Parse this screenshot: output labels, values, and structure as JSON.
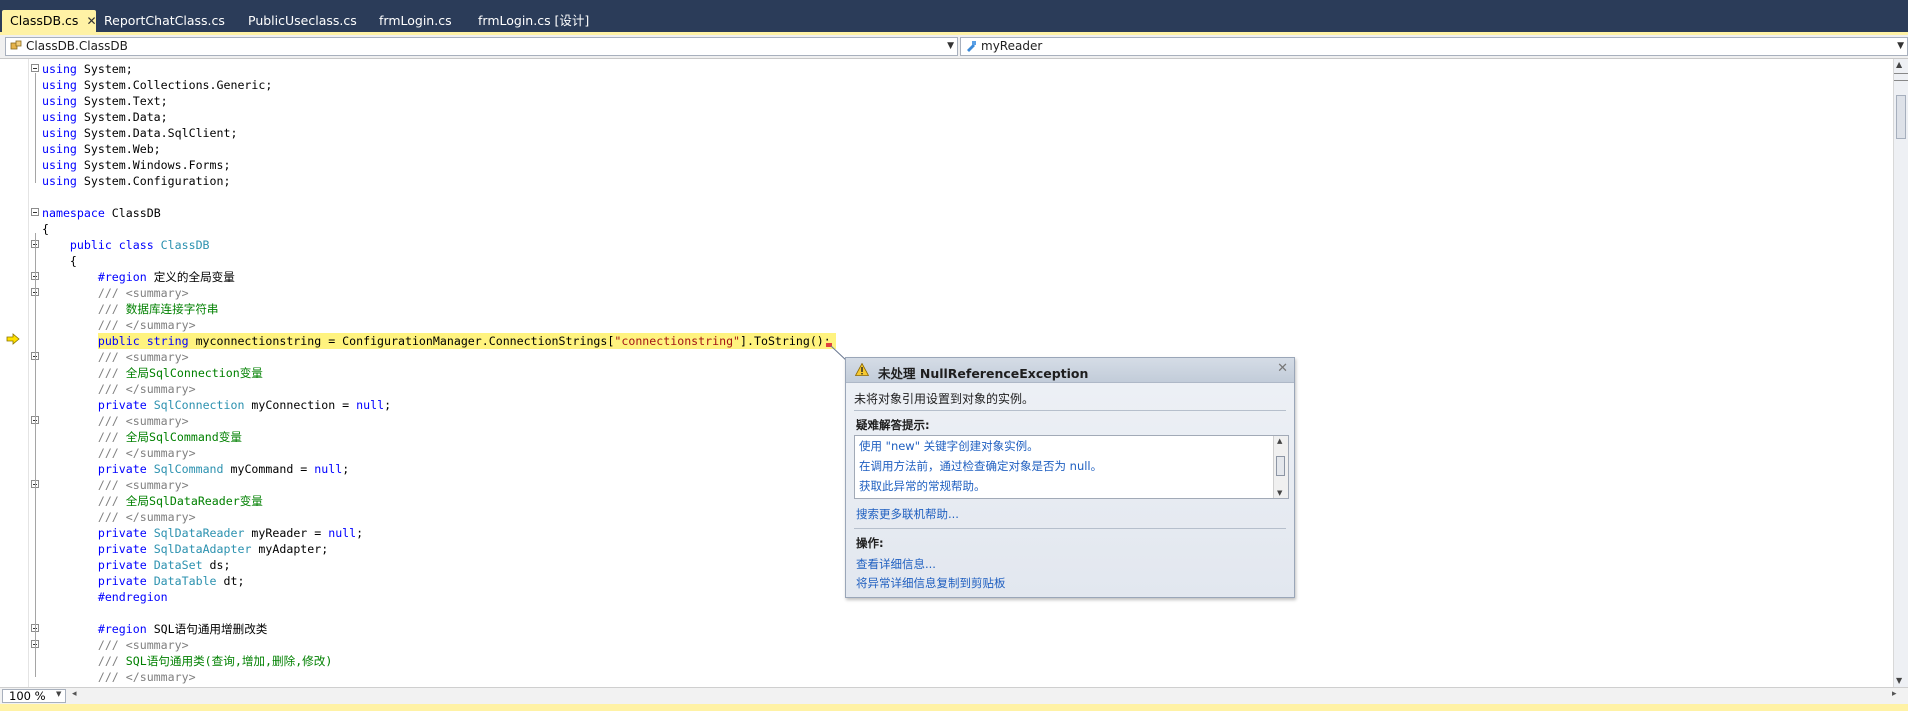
{
  "tabs": [
    {
      "label": "ClassDB.cs",
      "active": true
    },
    {
      "label": "ReportChatClass.cs",
      "active": false
    },
    {
      "label": "PublicUseclass.cs",
      "active": false
    },
    {
      "label": "frmLogin.cs",
      "active": false
    },
    {
      "label": "frmLogin.cs [设计]",
      "active": false
    }
  ],
  "nav": {
    "class_combo": "ClassDB.ClassDB",
    "member_combo": "myReader"
  },
  "code_lines": [
    [
      [
        "kw",
        "using"
      ],
      [
        "pl",
        " System;"
      ]
    ],
    [
      [
        "kw",
        "using"
      ],
      [
        "pl",
        " System.Collections.Generic;"
      ]
    ],
    [
      [
        "kw",
        "using"
      ],
      [
        "pl",
        " System.Text;"
      ]
    ],
    [
      [
        "kw",
        "using"
      ],
      [
        "pl",
        " System.Data;"
      ]
    ],
    [
      [
        "kw",
        "using"
      ],
      [
        "pl",
        " System.Data.SqlClient;"
      ]
    ],
    [
      [
        "kw",
        "using"
      ],
      [
        "pl",
        " System.Web;"
      ]
    ],
    [
      [
        "kw",
        "using"
      ],
      [
        "pl",
        " System.Windows.Forms;"
      ]
    ],
    [
      [
        "kw",
        "using"
      ],
      [
        "pl",
        " System.Configuration;"
      ]
    ],
    [],
    [
      [
        "kw",
        "namespace"
      ],
      [
        "pl",
        " ClassDB"
      ]
    ],
    [
      [
        "pl",
        "{"
      ]
    ],
    [
      [
        "pl",
        "    "
      ],
      [
        "kw",
        "public class"
      ],
      [
        "pl",
        " "
      ],
      [
        "ty",
        "ClassDB"
      ]
    ],
    [
      [
        "pl",
        "    {"
      ]
    ],
    [
      [
        "pl",
        "        "
      ],
      [
        "kw",
        "#region"
      ],
      [
        "pl",
        " 定义的全局变量"
      ]
    ],
    [
      [
        "pl",
        "        "
      ],
      [
        "cg",
        "/// <summary>"
      ]
    ],
    [
      [
        "pl",
        "        "
      ],
      [
        "cg",
        "///"
      ],
      [
        "cm",
        " 数据库连接字符串"
      ]
    ],
    [
      [
        "pl",
        "        "
      ],
      [
        "cg",
        "/// </summary>"
      ]
    ],
    [
      [
        "pl",
        "        "
      ],
      [
        "kw",
        "public string"
      ],
      [
        "pl",
        " myconnectionstring = ConfigurationManager.ConnectionStrings["
      ],
      [
        "st",
        "\"connectionstring\""
      ],
      [
        "pl",
        "].ToString();"
      ]
    ],
    [
      [
        "pl",
        "        "
      ],
      [
        "cg",
        "/// <summary>"
      ]
    ],
    [
      [
        "pl",
        "        "
      ],
      [
        "cg",
        "///"
      ],
      [
        "cm",
        " 全局SqlConnection变量"
      ]
    ],
    [
      [
        "pl",
        "        "
      ],
      [
        "cg",
        "/// </summary>"
      ]
    ],
    [
      [
        "pl",
        "        "
      ],
      [
        "kw",
        "private"
      ],
      [
        "pl",
        " "
      ],
      [
        "ty",
        "SqlConnection"
      ],
      [
        "pl",
        " myConnection = "
      ],
      [
        "kw",
        "null"
      ],
      [
        "pl",
        ";"
      ]
    ],
    [
      [
        "pl",
        "        "
      ],
      [
        "cg",
        "/// <summary>"
      ]
    ],
    [
      [
        "pl",
        "        "
      ],
      [
        "cg",
        "///"
      ],
      [
        "cm",
        " 全局SqlCommand变量"
      ]
    ],
    [
      [
        "pl",
        "        "
      ],
      [
        "cg",
        "/// </summary>"
      ]
    ],
    [
      [
        "pl",
        "        "
      ],
      [
        "kw",
        "private"
      ],
      [
        "pl",
        " "
      ],
      [
        "ty",
        "SqlCommand"
      ],
      [
        "pl",
        " myCommand = "
      ],
      [
        "kw",
        "null"
      ],
      [
        "pl",
        ";"
      ]
    ],
    [
      [
        "pl",
        "        "
      ],
      [
        "cg",
        "/// <summary>"
      ]
    ],
    [
      [
        "pl",
        "        "
      ],
      [
        "cg",
        "///"
      ],
      [
        "cm",
        " 全局SqlDataReader变量"
      ]
    ],
    [
      [
        "pl",
        "        "
      ],
      [
        "cg",
        "/// </summary>"
      ]
    ],
    [
      [
        "pl",
        "        "
      ],
      [
        "kw",
        "private"
      ],
      [
        "pl",
        " "
      ],
      [
        "ty",
        "SqlDataReader"
      ],
      [
        "pl",
        " myReader = "
      ],
      [
        "kw",
        "null"
      ],
      [
        "pl",
        ";"
      ]
    ],
    [
      [
        "pl",
        "        "
      ],
      [
        "kw",
        "private"
      ],
      [
        "pl",
        " "
      ],
      [
        "ty",
        "SqlDataAdapter"
      ],
      [
        "pl",
        " myAdapter;"
      ]
    ],
    [
      [
        "pl",
        "        "
      ],
      [
        "kw",
        "private"
      ],
      [
        "pl",
        " "
      ],
      [
        "ty",
        "DataSet"
      ],
      [
        "pl",
        " ds;"
      ]
    ],
    [
      [
        "pl",
        "        "
      ],
      [
        "kw",
        "private"
      ],
      [
        "pl",
        " "
      ],
      [
        "ty",
        "DataTable"
      ],
      [
        "pl",
        " dt;"
      ]
    ],
    [
      [
        "pl",
        "        "
      ],
      [
        "kw",
        "#endregion"
      ]
    ],
    [],
    [
      [
        "pl",
        "        "
      ],
      [
        "kw",
        "#region"
      ],
      [
        "pl",
        " SQL语句通用增删改类"
      ]
    ],
    [
      [
        "pl",
        "        "
      ],
      [
        "cg",
        "/// <summary>"
      ]
    ],
    [
      [
        "pl",
        "        "
      ],
      [
        "cg",
        "///"
      ],
      [
        "cm",
        " SQL语句通用类(查询,增加,删除,修改)"
      ]
    ],
    [
      [
        "pl",
        "        "
      ],
      [
        "cg",
        "/// </summary>"
      ]
    ]
  ],
  "exception": {
    "title": "未处理 NullReferenceException",
    "message": "未将对象引用设置到对象的实例。",
    "tips_label": "疑难解答提示:",
    "tips": [
      "使用 \"new\" 关键字创建对象实例。",
      "在调用方法前，通过检查确定对象是否为 null。",
      "获取此异常的常规帮助。"
    ],
    "search_more": "搜索更多联机帮助...",
    "actions_label": "操作:",
    "actions": [
      "查看详细信息...",
      "将异常详细信息复制到剪贴板"
    ]
  },
  "status": {
    "zoom": "100 %"
  },
  "colors": {
    "keyword": "#0000ff",
    "type": "#2b91af",
    "comment": "#008000",
    "doc_tag": "#808080",
    "string": "#a31515",
    "current_line": "#fff37f",
    "tab_active": "#fff2a5",
    "tab_strip": "#2b3c59",
    "link": "#1f5fc0"
  }
}
